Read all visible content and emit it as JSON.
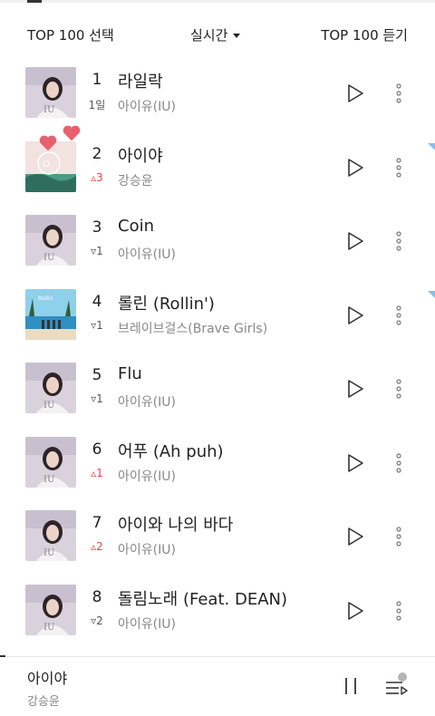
{
  "header": {
    "select_top100": "TOP 100 선택",
    "chart_mode": "실시간",
    "listen_top100": "TOP 100 듣기"
  },
  "songs": [
    {
      "rank": "1",
      "change": "1일",
      "change_dir": "new",
      "title": "라일락",
      "artist": "아이유(IU)",
      "art": "iu"
    },
    {
      "rank": "2",
      "change": "▵3",
      "change_dir": "up",
      "title": "아이야",
      "artist": "강승윤",
      "art": "sea"
    },
    {
      "rank": "3",
      "change": "▿1",
      "change_dir": "down",
      "title": "Coin",
      "artist": "아이유(IU)",
      "art": "iu"
    },
    {
      "rank": "4",
      "change": "▿1",
      "change_dir": "down",
      "title": "롤린 (Rollin')",
      "artist": "브레이브걸스(Brave Girls)",
      "art": "beach"
    },
    {
      "rank": "5",
      "change": "▿1",
      "change_dir": "down",
      "title": "Flu",
      "artist": "아이유(IU)",
      "art": "iu"
    },
    {
      "rank": "6",
      "change": "▵1",
      "change_dir": "up",
      "title": "어푸 (Ah puh)",
      "artist": "아이유(IU)",
      "art": "iu"
    },
    {
      "rank": "7",
      "change": "▵2",
      "change_dir": "up",
      "title": "아이와 나의 바다",
      "artist": "아이유(IU)",
      "art": "iu"
    },
    {
      "rank": "8",
      "change": "▿2",
      "change_dir": "down",
      "title": "돌림노래 (Feat. DEAN)",
      "artist": "아이유(IU)",
      "art": "iu"
    }
  ],
  "mini_player": {
    "title": "아이야",
    "artist": "강승윤"
  },
  "colors": {
    "up": "#e04848",
    "corner_tag": "#8fb9e6",
    "heart": "#e8606e"
  },
  "icons": {
    "play": "play-triangle-icon",
    "more": "vertical-dots-icon",
    "pause": "pause-icon",
    "queue": "playlist-icon"
  }
}
